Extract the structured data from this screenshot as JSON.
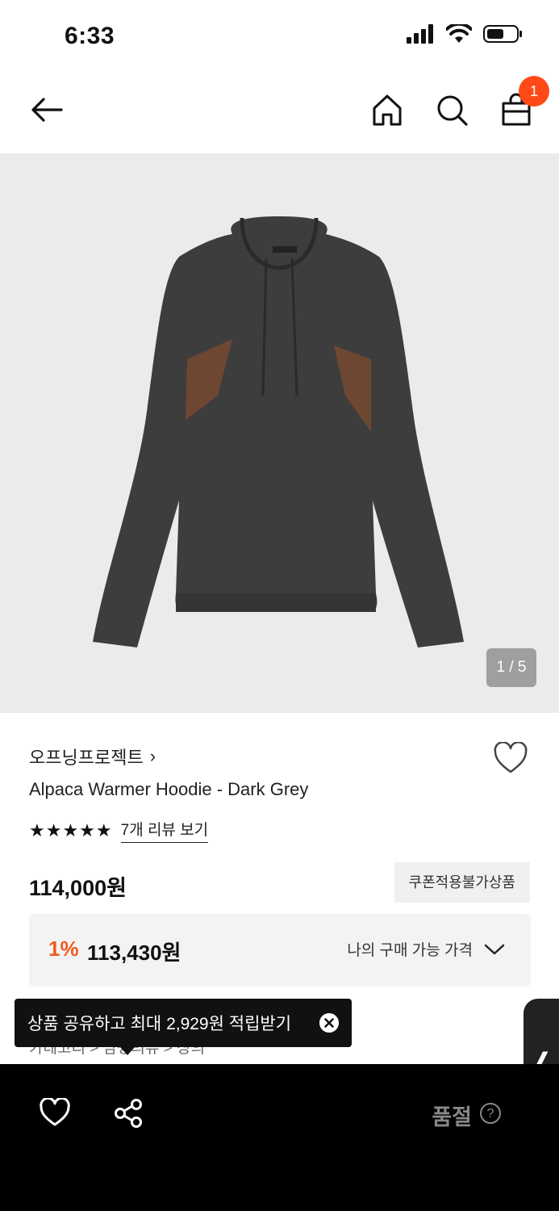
{
  "status_bar": {
    "time": "6:33"
  },
  "nav": {
    "cart_badge": "1"
  },
  "hero": {
    "image_counter": "1 / 5"
  },
  "product": {
    "brand": "오프닝프로젝트",
    "brand_chevron": "›",
    "name": "Alpaca Warmer Hoodie - Dark Grey",
    "stars": "★★★★★",
    "review_link": "7개 리뷰 보기",
    "price": "114,000원",
    "coupon_tag": "쿠폰적용불가상품",
    "discount_rate": "1%",
    "discount_price": "113,430원",
    "my_price_label": "나의 구매 가능 가격"
  },
  "obscured": {
    "text": "카테고리  >  남성의류  >  상의"
  },
  "tooltip": {
    "text": "상품 공유하고 최대 2,929원 적립받기"
  },
  "side_tab": {
    "glyph": "❬"
  },
  "bottom_bar": {
    "soldout": "품절",
    "help": "?"
  },
  "colors": {
    "accent": "#ff4a17",
    "discount": "#ef5b1f",
    "bottom_bar": "#000000"
  }
}
